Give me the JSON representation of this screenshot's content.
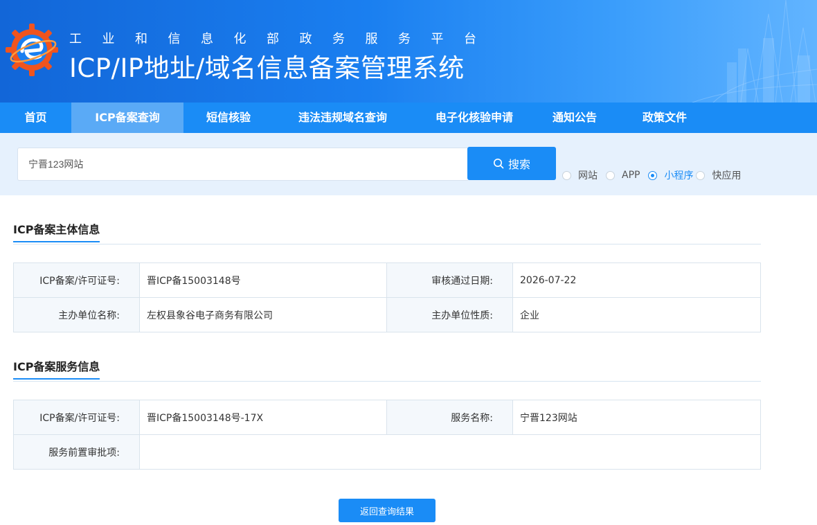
{
  "header": {
    "subtitle": "工业和信息化部政务服务平台",
    "title": "ICP/IP地址/域名信息备案管理系统"
  },
  "nav": {
    "items": [
      {
        "label": "首页"
      },
      {
        "label": "ICP备案查询"
      },
      {
        "label": "短信核验"
      },
      {
        "label": "违法违规域名查询"
      },
      {
        "label": "电子化核验申请"
      },
      {
        "label": "通知公告"
      },
      {
        "label": "政策文件"
      }
    ],
    "active_index": 1
  },
  "search": {
    "value": "宁晋123网站",
    "button_label": "搜索",
    "options": [
      {
        "label": "网站",
        "checked": false
      },
      {
        "label": "APP",
        "checked": false
      },
      {
        "label": "小程序",
        "checked": true
      },
      {
        "label": "快应用",
        "checked": false
      }
    ]
  },
  "subject": {
    "section_title": "ICP备案主体信息",
    "license_label": "ICP备案/许可证号:",
    "license_value": "晋ICP备15003148号",
    "approve_date_label": "审核通过日期:",
    "approve_date_value": "2026-07-22",
    "org_name_label": "主办单位名称:",
    "org_name_value": "左权县象谷电子商务有限公司",
    "org_type_label": "主办单位性质:",
    "org_type_value": "企业"
  },
  "service": {
    "section_title": "ICP备案服务信息",
    "license_label": "ICP备案/许可证号:",
    "license_value": "晋ICP备15003148号-17X",
    "name_label": "服务名称:",
    "name_value": "宁晋123网站",
    "pre_approval_label": "服务前置审批项:",
    "pre_approval_value": ""
  },
  "back_button_label": "返回查询结果",
  "colors": {
    "primary": "#1a8cf6",
    "nav_active": "#5aaaf6",
    "search_band": "#e6f1fd"
  }
}
